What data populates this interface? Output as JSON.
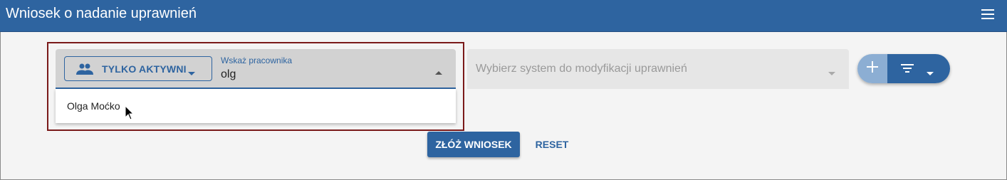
{
  "header": {
    "title": "Wniosek o nadanie uprawnień",
    "menu_icon": "hamburger-menu-icon"
  },
  "employee_selector": {
    "filter_toggle_label": "TYLKO AKTYWNI",
    "filter_toggle_icon": "people-icon",
    "field_label": "Wskaż pracownika",
    "value": "olg",
    "suggestions": [
      "Olga Moćko"
    ]
  },
  "system_selector": {
    "placeholder": "Wybierz system do modyfikacji uprawnień"
  },
  "actions": {
    "add_icon": "plus-icon",
    "filter_icon": "filter-icon",
    "submit_label": "ZŁÓŻ WNIOSEK",
    "reset_label": "RESET"
  },
  "colors": {
    "primary": "#2e64a0",
    "add_button": "#8caed3",
    "highlight_border": "#7a1a1a",
    "background": "#f4f4f4"
  }
}
